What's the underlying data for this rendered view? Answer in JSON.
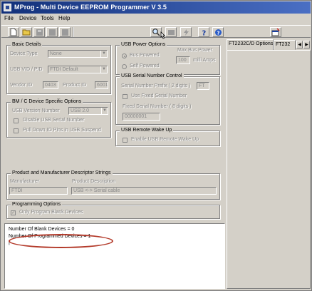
{
  "window": {
    "title": "MProg - Multi Device EEPROM Programmer V 3.5"
  },
  "menu": [
    "File",
    "Device",
    "Tools",
    "Help"
  ],
  "toolbar": {
    "left_icons": [
      "new-file-icon",
      "open-folder-icon",
      "save-icon",
      "program-icon",
      "stop-icon"
    ],
    "right_icons": [
      "search-icon",
      "read-device-icon",
      "flash-icon",
      "help-icon",
      "about-icon"
    ],
    "far_right_icon": "window-icon"
  },
  "basic_details": {
    "title": "Basic Details",
    "device_type_label": "Device Type",
    "device_type_value": "None",
    "usb_vidpid_label": "USB VID / PID",
    "usb_vidpid_value": "FTDI Default",
    "vendor_id_label": "Vendor ID",
    "vendor_id_value": "0403",
    "product_id_label": "Product ID",
    "product_id_value": "6001"
  },
  "bm_options": {
    "title": "BM / C Device Specific Options",
    "usb_version_label": "USB Version Number",
    "usb_version_value": "USB 2.0",
    "disable_serial_label": "Disable USB Serial Number",
    "pull_down_label": "Pull Down IO Pins in USB Suspend"
  },
  "usb_power": {
    "title": "USB Power Options",
    "bus_powered_label": "Bus Powered",
    "self_powered_label": "Self Powered",
    "max_power_label": "Max Bus Power",
    "max_power_value": "100",
    "max_power_unit": "milli Amps"
  },
  "usb_serial": {
    "title": "USB Serial Number Control",
    "prefix_label": "Serial Number Prefix ( 2 digits )",
    "prefix_value": "FT",
    "use_fixed_label": "Use Fixed Serial Number",
    "fixed_label": "Fixed Serial Number ( 8 digits )",
    "fixed_value": "00000001"
  },
  "remote_wakeup": {
    "title": "USB Remote Wake Up",
    "enable_label": "Enable USB Remote Wake Up"
  },
  "descriptors": {
    "title": "Product and Manufacturer Descriptor Strings",
    "manufacturer_label": "Manufacturer",
    "manufacturer_value": "FTDI",
    "product_label": "Product Description",
    "product_value": "USB <-> Serial cable"
  },
  "programming": {
    "title": "Programming Options",
    "only_blank_label": "Only Program Blank Devices"
  },
  "output": {
    "line1": "Number Of Blank Devices = 0",
    "line2": "Number Of Programmed Devices = 1",
    "line3": "|"
  },
  "tabs": [
    "FT2232C/D Options",
    "FT232"
  ],
  "colors": {
    "titlebar": "#12307a",
    "window_bg": "#d4d0c8",
    "annotation": "#b33a2a"
  }
}
